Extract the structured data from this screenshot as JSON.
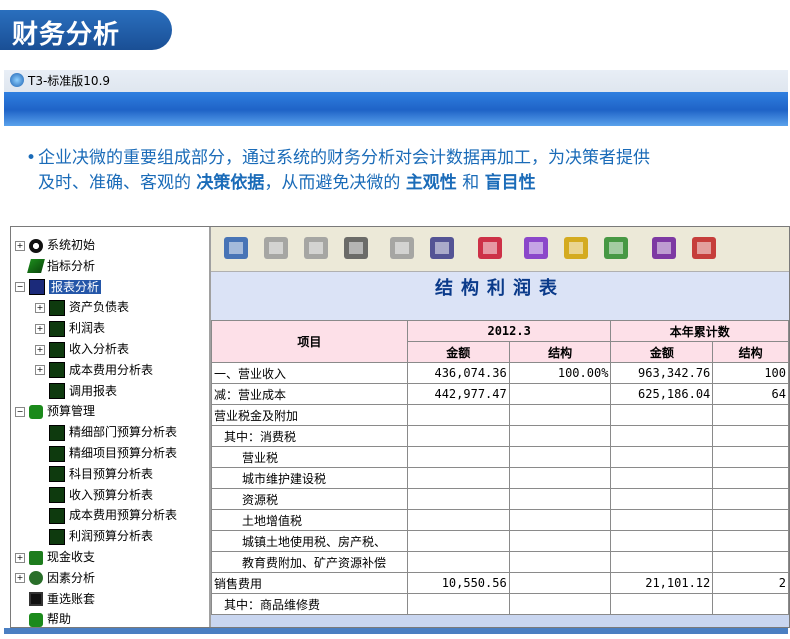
{
  "banner": {
    "title": "财务分析"
  },
  "window": {
    "title": "T3-标准版10.9"
  },
  "description": {
    "line1": "企业决微的重要组成部分，通过系统的财务分析对会计数据再加工，为决策者提供",
    "line2a": "及时、准确、客观的 ",
    "b1": "决策依据",
    "line2b": "，从而避免决微的 ",
    "b2": "主观性",
    "line2c": " 和 ",
    "b3": "盲目性"
  },
  "tree": [
    {
      "label": "系统初始",
      "icon": "gear-icon",
      "expander": "+"
    },
    {
      "label": "指标分析",
      "icon": "chart-icon",
      "expander": ""
    },
    {
      "label": "报表分析",
      "icon": "report-icon",
      "expander": "−",
      "selected": true
    },
    {
      "label": "资产负债表",
      "icon": "document-icon",
      "expander": "+"
    },
    {
      "label": "利润表",
      "icon": "document-icon",
      "expander": "+"
    },
    {
      "label": "收入分析表",
      "icon": "document-icon",
      "expander": "+"
    },
    {
      "label": "成本费用分析表",
      "icon": "document-icon",
      "expander": "+"
    },
    {
      "label": "调用报表",
      "icon": "document-icon",
      "expander": ""
    },
    {
      "label": "预算管理",
      "icon": "budget-icon",
      "expander": "−"
    },
    {
      "label": "精细部门预算分析表",
      "icon": "document-icon",
      "expander": ""
    },
    {
      "label": "精细项目预算分析表",
      "icon": "document-icon",
      "expander": ""
    },
    {
      "label": "科目预算分析表",
      "icon": "document-icon",
      "expander": ""
    },
    {
      "label": "收入预算分析表",
      "icon": "document-icon",
      "expander": ""
    },
    {
      "label": "成本费用预算分析表",
      "icon": "document-icon",
      "expander": ""
    },
    {
      "label": "利润预算分析表",
      "icon": "document-icon",
      "expander": ""
    },
    {
      "label": "现金收支",
      "icon": "money-icon",
      "expander": "+"
    },
    {
      "label": "因素分析",
      "icon": "factor-icon",
      "expander": "+"
    },
    {
      "label": "重选账套",
      "icon": "save-icon",
      "expander": ""
    },
    {
      "label": "帮助",
      "icon": "help-icon",
      "expander": ""
    }
  ],
  "toolbar": {
    "buttons": [
      "monitor-icon",
      "printer-icon",
      "print-settings-icon",
      "page-setup-icon",
      "export-icon",
      "hand-icon",
      "heart-chart-icon",
      "bar-chart-icon",
      "line-chart-icon",
      "pie-chart-icon",
      "help-book-icon",
      "exit-door-icon"
    ]
  },
  "report": {
    "title": "结构利润表",
    "header": {
      "item": "项目",
      "period1": "2012.3",
      "period2": "本年累计数",
      "amount": "金额",
      "structure": "结构"
    },
    "rows": [
      {
        "item": "一、营业收入",
        "a1": "436,074.36",
        "s1": "100.00%",
        "a2": "963,342.76",
        "s2": "100"
      },
      {
        "item": "减：营业成本",
        "a1": "442,977.47",
        "s1": "",
        "a2": "625,186.04",
        "s2": "64"
      },
      {
        "item": "营业税金及附加",
        "a1": "",
        "s1": "",
        "a2": "",
        "s2": ""
      },
      {
        "item": "其中：消费税",
        "a1": "",
        "s1": "",
        "a2": "",
        "s2": ""
      },
      {
        "item": "营业税",
        "a1": "",
        "s1": "",
        "a2": "",
        "s2": ""
      },
      {
        "item": "城市维护建设税",
        "a1": "",
        "s1": "",
        "a2": "",
        "s2": ""
      },
      {
        "item": "资源税",
        "a1": "",
        "s1": "",
        "a2": "",
        "s2": ""
      },
      {
        "item": "土地增值税",
        "a1": "",
        "s1": "",
        "a2": "",
        "s2": ""
      },
      {
        "item": "城镇土地使用税、房产税、",
        "a1": "",
        "s1": "",
        "a2": "",
        "s2": ""
      },
      {
        "item": "教育费附加、矿产资源补偿",
        "a1": "",
        "s1": "",
        "a2": "",
        "s2": ""
      },
      {
        "item": "销售费用",
        "a1": "10,550.56",
        "s1": "",
        "a2": "21,101.12",
        "s2": "2"
      },
      {
        "item": "其中：商品维修费",
        "a1": "",
        "s1": "",
        "a2": "",
        "s2": ""
      }
    ]
  }
}
